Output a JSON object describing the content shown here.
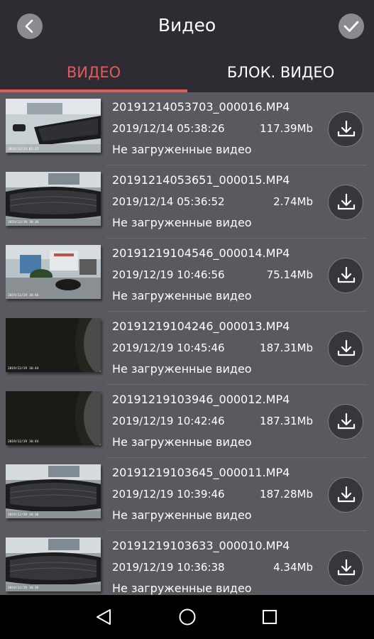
{
  "header": {
    "title": "Видео",
    "back_icon": "chevron-left-icon",
    "confirm_icon": "checkmark-icon"
  },
  "tabs": [
    {
      "label": "ВИДЕО",
      "active": true
    },
    {
      "label": "БЛОК. ВИДЕО",
      "active": false
    }
  ],
  "colors": {
    "accent": "#e05b5d",
    "header_bg": "#2f2b33",
    "list_bg": "#5b5960"
  },
  "videos": [
    {
      "name": "20191214053703_000016.MP4",
      "date": "2019/12/14 05:38:26",
      "size": "117.39Mb",
      "status": "Не загруженные видео",
      "thumb": "desk-keyboard-bright"
    },
    {
      "name": "20191214053651_000015.MP4",
      "date": "2019/12/14 05:36:52",
      "size": "2.74Mb",
      "status": "Не загруженные видео",
      "thumb": "keyboard-fisheye"
    },
    {
      "name": "20191219104546_000014.MP4",
      "date": "2019/12/19 10:46:56",
      "size": "75.14Mb",
      "status": "Не загруженные видео",
      "thumb": "office-room"
    },
    {
      "name": "20191219104246_000013.MP4",
      "date": "2019/12/19 10:45:46",
      "size": "187.31Mb",
      "status": "Не загруженные видео",
      "thumb": "dark-lens"
    },
    {
      "name": "20191219103946_000012.MP4",
      "date": "2019/12/19 10:42:46",
      "size": "187.31Mb",
      "status": "Не загруженные видео",
      "thumb": "dark-lens"
    },
    {
      "name": "20191219103645_000011.MP4",
      "date": "2019/12/19 10:39:46",
      "size": "187.28Mb",
      "status": "Не загруженные видео",
      "thumb": "keyboard-fisheye"
    },
    {
      "name": "20191219103633_000010.MP4",
      "date": "2019/12/19 10:36:38",
      "size": "4.34Mb",
      "status": "Не загруженные видео",
      "thumb": "keyboard-fisheye"
    }
  ],
  "download_icon": "download-tray-icon",
  "navbar": {
    "back_icon": "triangle-back-icon",
    "home_icon": "circle-home-icon",
    "recent_icon": "square-recents-icon"
  }
}
